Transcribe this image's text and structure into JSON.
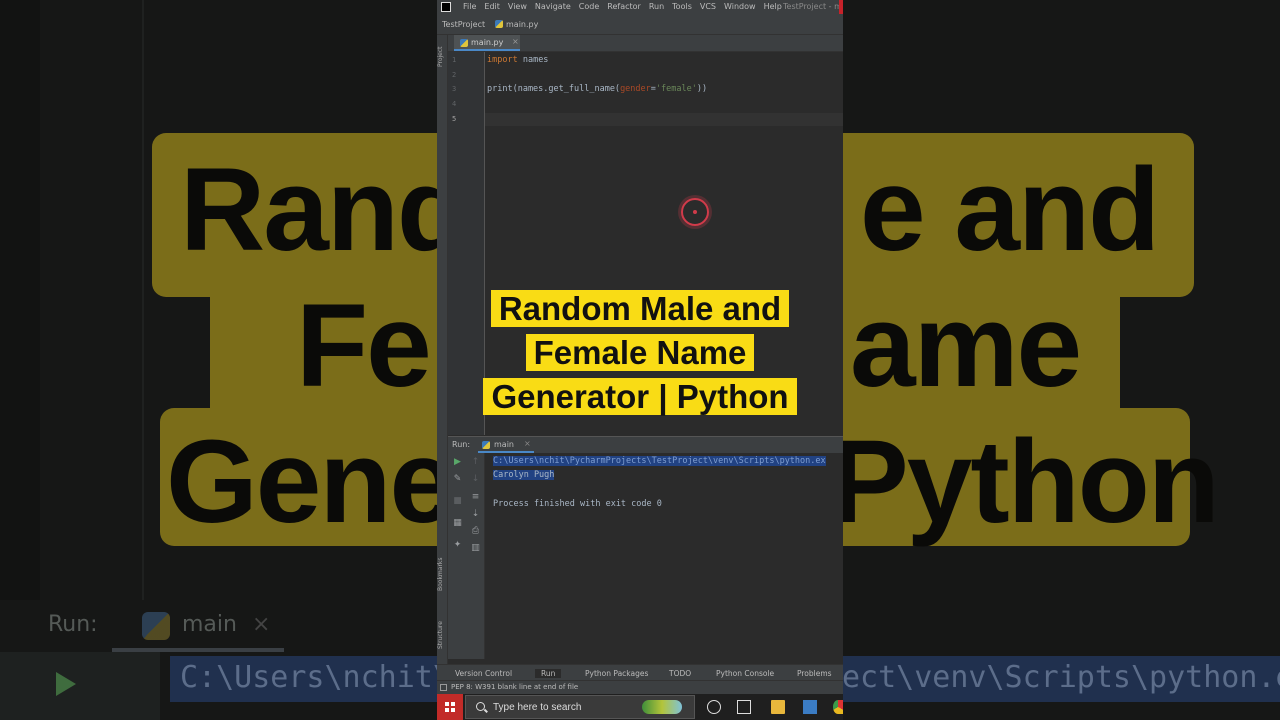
{
  "background": {
    "big_words": [
      "Rand",
      "e and",
      "Fe",
      "ame",
      "Gene",
      "Python"
    ],
    "run_label": "Run:",
    "run_tab": "main",
    "path_left": "C:\\Users\\nchit\\",
    "path_right": "ect\\venv\\Scripts\\python.ex"
  },
  "menubar": {
    "items": [
      "File",
      "Edit",
      "View",
      "Navigate",
      "Code",
      "Refactor",
      "Run",
      "Tools",
      "VCS",
      "Window",
      "Help"
    ],
    "title": "TestProject - ma"
  },
  "navbar": {
    "project": "TestProject",
    "file": "main.py"
  },
  "left_tool_labels": {
    "project": "Project",
    "bookmarks": "Bookmarks",
    "structure": "Structure"
  },
  "editor_tab": {
    "label": "main.py"
  },
  "gutter": [
    "1",
    "2",
    "3",
    "4",
    "5"
  ],
  "code": {
    "line1_kw": "import",
    "line1_rest": " names",
    "line3_a": "print(names.get_full_name(",
    "line3_param": "gender",
    "line3_eq": "=",
    "line3_str": "'female'",
    "line3_end": "))"
  },
  "overlay": {
    "line1": "Random Male and",
    "line2": "Female Name",
    "line3": "Generator | Python"
  },
  "run_panel": {
    "label": "Run:",
    "tab": "main",
    "output_path": "C:\\Users\\nchit\\PycharmProjects\\TestProject\\venv\\Scripts\\python.ex",
    "output_name": "Carolyn Pugh",
    "output_exit": "Process finished with exit code 0"
  },
  "bottom_tabs": [
    "Version Control",
    "Run",
    "Python Packages",
    "TODO",
    "Python Console",
    "Problems"
  ],
  "status": {
    "message": "PEP 8: W391 blank line at end of file"
  },
  "taskbar": {
    "search_placeholder": "Type here to search"
  },
  "colors": {
    "accent_yellow": "#f9dc15",
    "editor_bg": "#2b2b2b",
    "selection": "#214283",
    "start_red": "#c22b28"
  }
}
